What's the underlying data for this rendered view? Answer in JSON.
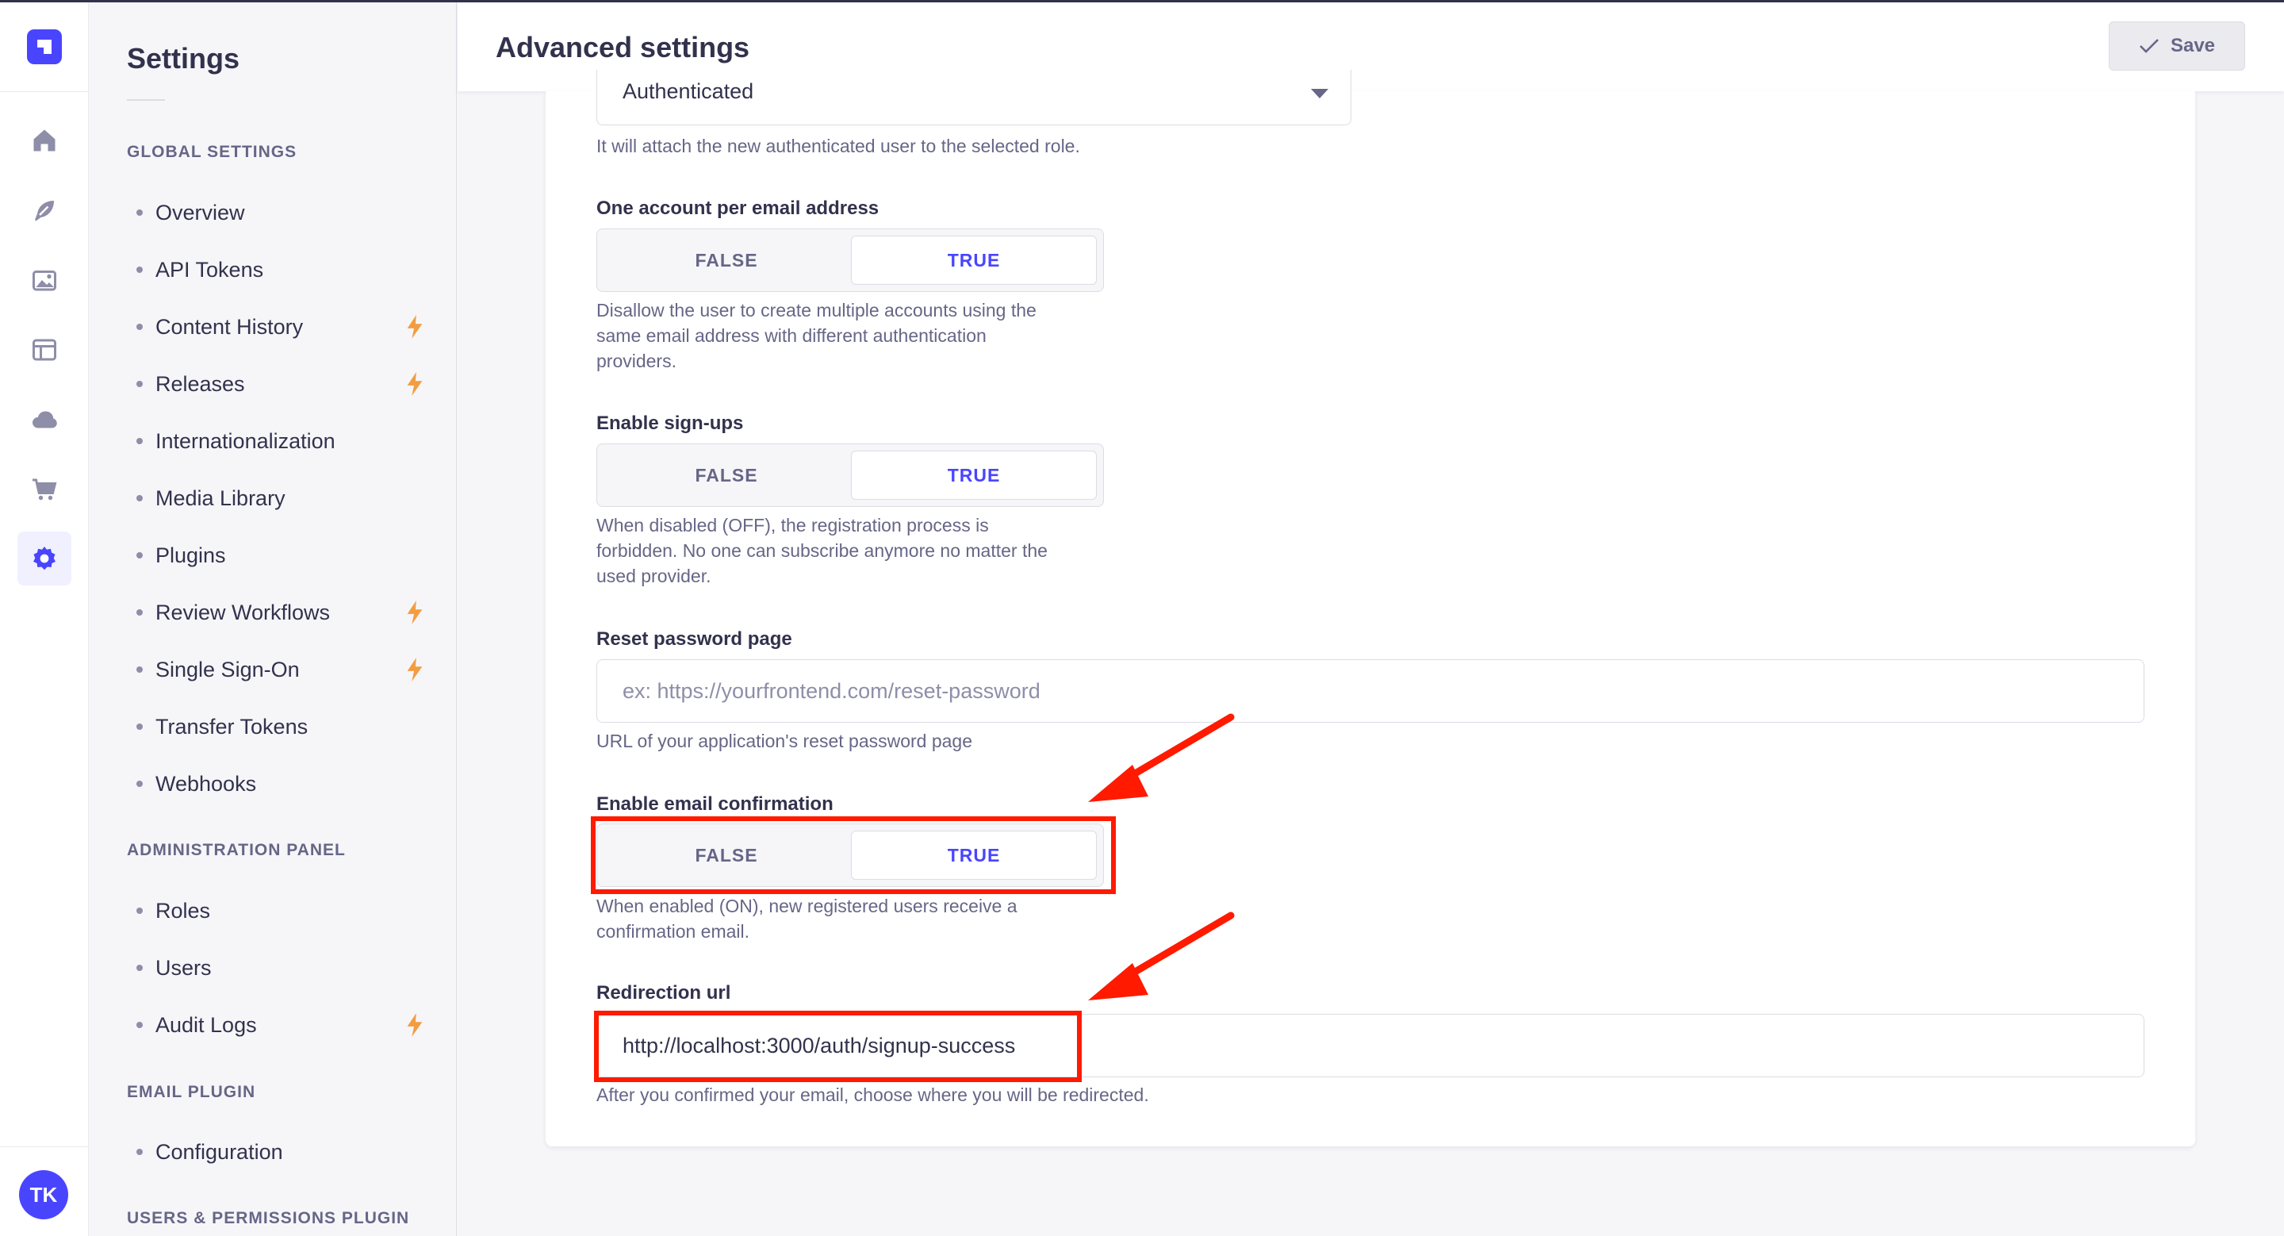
{
  "rail": {
    "avatar_initials": "TK"
  },
  "subnav": {
    "title": "Settings",
    "sections": [
      {
        "heading": "GLOBAL SETTINGS",
        "items": [
          {
            "label": "Overview",
            "premium": false
          },
          {
            "label": "API Tokens",
            "premium": false
          },
          {
            "label": "Content History",
            "premium": true
          },
          {
            "label": "Releases",
            "premium": true
          },
          {
            "label": "Internationalization",
            "premium": false
          },
          {
            "label": "Media Library",
            "premium": false
          },
          {
            "label": "Plugins",
            "premium": false
          },
          {
            "label": "Review Workflows",
            "premium": true
          },
          {
            "label": "Single Sign-On",
            "premium": true
          },
          {
            "label": "Transfer Tokens",
            "premium": false
          },
          {
            "label": "Webhooks",
            "premium": false
          }
        ]
      },
      {
        "heading": "ADMINISTRATION PANEL",
        "items": [
          {
            "label": "Roles",
            "premium": false
          },
          {
            "label": "Users",
            "premium": false
          },
          {
            "label": "Audit Logs",
            "premium": true
          }
        ]
      },
      {
        "heading": "EMAIL PLUGIN",
        "items": [
          {
            "label": "Configuration",
            "premium": false
          }
        ]
      },
      {
        "heading": "USERS & PERMISSIONS PLUGIN",
        "items": []
      }
    ]
  },
  "header": {
    "title": "Advanced settings",
    "save_label": "Save"
  },
  "form": {
    "default_role": {
      "value": "Authenticated",
      "hint": "It will attach the new authenticated user to the selected role."
    },
    "one_account": {
      "label": "One account per email address",
      "false_label": "FALSE",
      "true_label": "TRUE",
      "selected": "TRUE",
      "hint_lines": [
        "Disallow the user to create multiple accounts using the",
        "same email address with different authentication",
        "providers."
      ]
    },
    "sign_ups": {
      "label": "Enable sign-ups",
      "false_label": "FALSE",
      "true_label": "TRUE",
      "selected": "TRUE",
      "hint_lines": [
        "When disabled (OFF), the registration process is",
        "forbidden. No one can subscribe anymore no matter the",
        "used provider."
      ]
    },
    "reset_password": {
      "label": "Reset password page",
      "placeholder": "ex: https://yourfrontend.com/reset-password",
      "hint": "URL of your application's reset password page"
    },
    "email_confirmation": {
      "label": "Enable email confirmation",
      "false_label": "FALSE",
      "true_label": "TRUE",
      "selected": "TRUE",
      "hint_lines": [
        "When enabled (ON), new registered users receive a",
        "confirmation email."
      ]
    },
    "redirection_url": {
      "label": "Redirection url",
      "value": "http://localhost:3000/auth/signup-success",
      "hint": "After you confirmed your email, choose where you will be redirected."
    }
  },
  "annotations": {
    "highlight_color": "#ff1a00"
  }
}
